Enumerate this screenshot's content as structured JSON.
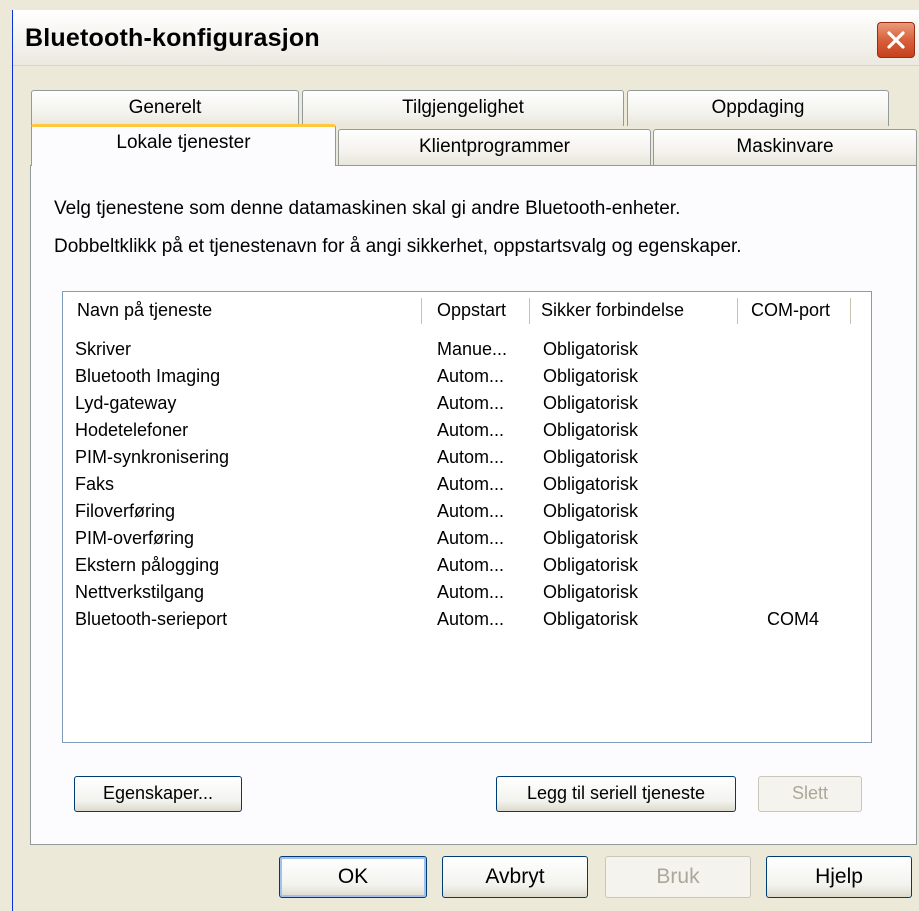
{
  "window": {
    "title": "Bluetooth-konfigurasjon"
  },
  "tabs_back": [
    {
      "label": "Generelt"
    },
    {
      "label": "Tilgjengelighet"
    },
    {
      "label": "Oppdaging"
    }
  ],
  "tabs_front": [
    {
      "label": "Lokale tjenester",
      "active": true
    },
    {
      "label": "Klientprogrammer"
    },
    {
      "label": "Maskinvare"
    }
  ],
  "panel": {
    "intro_line1": "Velg tjenestene som denne datamaskinen skal gi andre Bluetooth-enheter.",
    "intro_line2": "Dobbeltklikk på et tjenestenavn for å angi sikkerhet, oppstartsvalg og egenskaper."
  },
  "list": {
    "columns": [
      "Navn på tjeneste",
      "Oppstart",
      "Sikker forbindelse",
      "COM-port"
    ],
    "rows": [
      [
        "Skriver",
        "Manue...",
        "Obligatorisk",
        ""
      ],
      [
        "Bluetooth Imaging",
        "Autom...",
        "Obligatorisk",
        ""
      ],
      [
        "Lyd-gateway",
        "Autom...",
        "Obligatorisk",
        ""
      ],
      [
        "Hodetelefoner",
        "Autom...",
        "Obligatorisk",
        ""
      ],
      [
        "PIM-synkronisering",
        "Autom...",
        "Obligatorisk",
        ""
      ],
      [
        "Faks",
        "Autom...",
        "Obligatorisk",
        ""
      ],
      [
        "Filoverføring",
        "Autom...",
        "Obligatorisk",
        ""
      ],
      [
        "PIM-overføring",
        "Autom...",
        "Obligatorisk",
        ""
      ],
      [
        "Ekstern pålogging",
        "Autom...",
        "Obligatorisk",
        ""
      ],
      [
        "Nettverkstilgang",
        "Autom...",
        "Obligatorisk",
        ""
      ],
      [
        "Bluetooth-serieport",
        "Autom...",
        "Obligatorisk",
        "COM4"
      ]
    ]
  },
  "panel_buttons": {
    "properties": "Egenskaper...",
    "add_serial": "Legg til seriell tjeneste",
    "delete": "Slett"
  },
  "dialog_buttons": {
    "ok": "OK",
    "cancel": "Avbryt",
    "apply": "Bruk",
    "help": "Hjelp"
  }
}
